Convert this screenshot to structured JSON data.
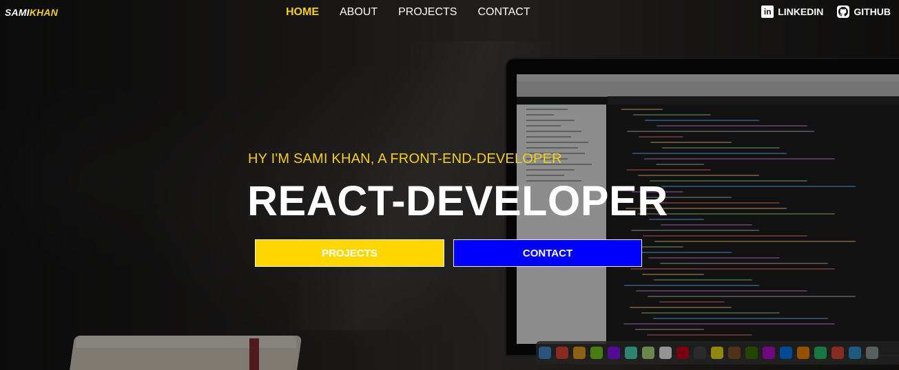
{
  "brand": {
    "part1": "SAMI",
    "part2": "KHAN"
  },
  "nav": {
    "items": [
      {
        "label": "HOME",
        "active": true
      },
      {
        "label": "ABOUT",
        "active": false
      },
      {
        "label": "PROJECTS",
        "active": false
      },
      {
        "label": "CONTACT",
        "active": false
      }
    ]
  },
  "social": [
    {
      "label": "LINKEDIN",
      "icon": "linkedin-icon"
    },
    {
      "label": "GITHUB",
      "icon": "github-icon"
    }
  ],
  "hero": {
    "subtitle": "HY I'M SAMI KHAN, A FRONT-END-DEVELOPER",
    "title": "REACT-DEVELOPER",
    "buttons": {
      "projects": "PROJECTS",
      "contact": "CONTACT"
    }
  },
  "colors": {
    "accent": "#f5cf1c",
    "projects_button": "#ffd700",
    "contact_button": "#0000ff"
  }
}
